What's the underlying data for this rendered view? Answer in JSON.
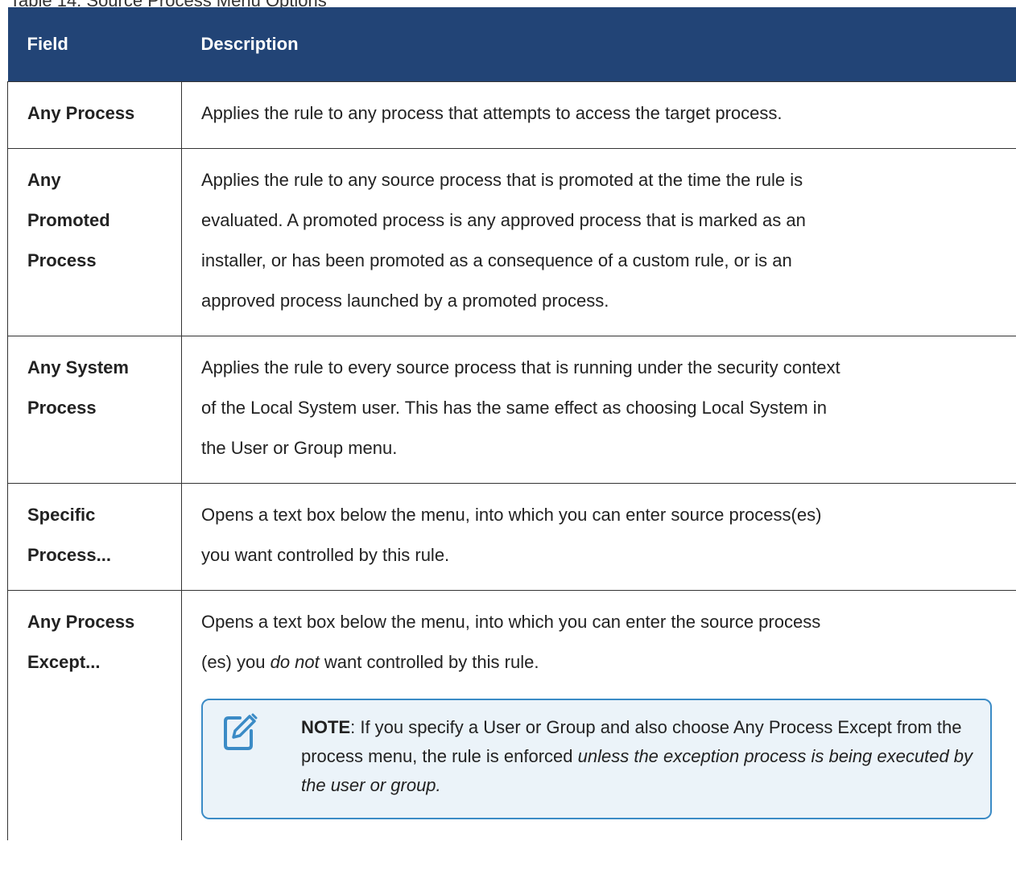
{
  "caption": "Table 14: Source Process Menu Options",
  "table": {
    "headers": [
      "Field",
      "Description"
    ],
    "rows": [
      {
        "field": [
          "Any Process"
        ],
        "description": [
          "Applies the rule to any process that attempts to access the target process."
        ]
      },
      {
        "field": [
          "Any",
          "Promoted",
          "Process"
        ],
        "description": [
          "Applies the rule to any source process that is promoted at the time the rule is",
          "evaluated. A promoted process is any approved process that is marked as an",
          "installer, or has been promoted as a consequence of a custom rule, or is an",
          "approved process launched by a promoted process."
        ]
      },
      {
        "field": [
          "Any System",
          "Process"
        ],
        "description": [
          "Applies the rule to every source process that is running under the security context",
          "of the Local System user. This has the same effect as choosing Local System in",
          "the User or Group menu."
        ]
      },
      {
        "field": [
          "Specific",
          "Process..."
        ],
        "description": [
          "Opens a text box below the menu, into which you can enter source process(es)",
          "you want controlled by this rule."
        ]
      },
      {
        "field": [
          "Any Process",
          "Except..."
        ],
        "description_line1": "Opens a text box below the menu, into which you can enter the source process",
        "description_line2_pre": "(es) you ",
        "description_line2_em": "do not",
        "description_line2_post": " want controlled by this rule.",
        "note": {
          "icon": "note-edit-icon",
          "label": "NOTE",
          "text": ": If you specify a User or Group and also choose Any Process Except from the process menu, the rule is enforced ",
          "emphasis": "unless the exception process is being executed by the user or group."
        }
      }
    ]
  },
  "colors": {
    "header_bg": "#224476",
    "header_text": "#ffffff",
    "note_border": "#3b8bc6",
    "note_bg": "#ebf3f9"
  }
}
